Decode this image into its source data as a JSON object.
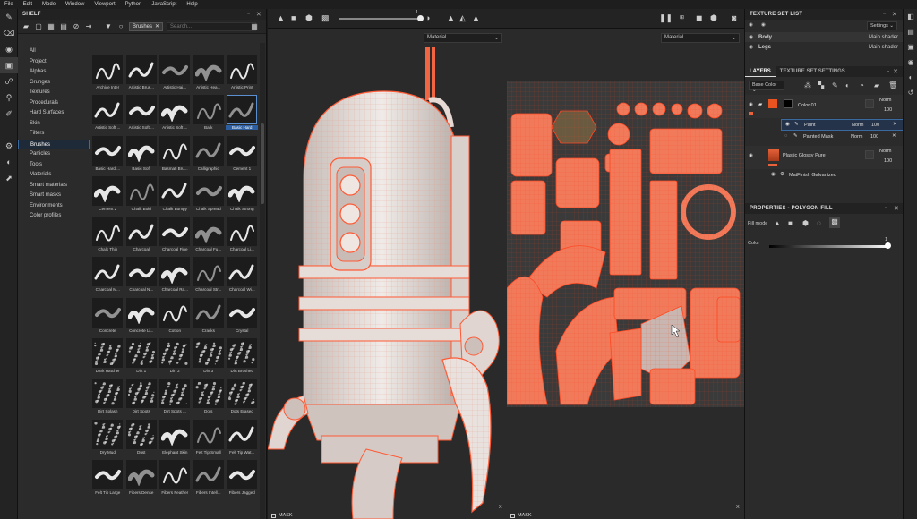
{
  "menu": [
    "File",
    "Edit",
    "Mode",
    "Window",
    "Viewport",
    "Python",
    "JavaScript",
    "Help"
  ],
  "shelf": {
    "title": "SHELF",
    "filter_chip": "Brushes",
    "search_placeholder": "Search...",
    "categories": [
      "All",
      "Project",
      "Alphas",
      "Grunges",
      "Textures",
      "Procedurals",
      "Hard Surfaces",
      "Skin",
      "Filters",
      "Brushes",
      "Particles",
      "Tools",
      "Materials",
      "Smart materials",
      "Smart masks",
      "Environments",
      "Color profiles"
    ],
    "selected_category": "Brushes",
    "brushes": [
      "Archive Inter",
      "Artistic Brus...",
      "Artistic Hai...",
      "Artistic Hea...",
      "Artistic Print",
      "Artistic Soft ...",
      "Artistic Soft ...",
      "Artistic Soft ...",
      "Bark",
      "Basic Hard",
      "Basic Hard ...",
      "Basic Soft",
      "Basmati Bru...",
      "Calligraphic",
      "Cement 1",
      "Cement 2",
      "Chalk Bold",
      "Chalk Bumpy",
      "Chalk Spread",
      "Chalk Strong",
      "Chalk Thin",
      "Charcoal",
      "Charcoal Fine",
      "Charcoal Fu...",
      "Charcoal Li...",
      "Charcoal M...",
      "Charcoal N...",
      "Charcoal Ra...",
      "Charcoal Str...",
      "Charcoal Wi...",
      "Concrete",
      "Concrete Li...",
      "Cotton",
      "Cracks",
      "Crystal",
      "Dark Hatcher",
      "Dirt 1",
      "Dirt 2",
      "Dirt 3",
      "Dirt Brushed",
      "Dirt Splash",
      "Dirt Spots",
      "Dirt Spots ...",
      "Dots",
      "Dots Erased",
      "Dry Mud",
      "Dust",
      "Elephant Skin",
      "Felt Tip Small",
      "Felt Tip Wat...",
      "Felt Tip Large",
      "Fibers Dense",
      "Fibers Feather",
      "Fibers Intell...",
      "Fibers Jagged"
    ],
    "selected_brush": "Basic Hard"
  },
  "viewport": {
    "slider_value": "1",
    "material_left": "Material",
    "material_right": "Material",
    "mask_left": "MASK",
    "mask_right": "MASK",
    "axis_left": "X",
    "axis_right": "X"
  },
  "texture_set_list": {
    "title": "TEXTURE SET LIST",
    "settings_label": "Settings",
    "items": [
      {
        "name": "Body",
        "shader": "Main shader"
      },
      {
        "name": "Legs",
        "shader": "Main shader"
      }
    ]
  },
  "layers": {
    "tab_layers": "LAYERS",
    "tab_settings": "TEXTURE SET SETTINGS",
    "channel": "Base Color",
    "rows": [
      {
        "name": "Color 01",
        "blend": "Norm",
        "opacity": "100"
      },
      {
        "name": "Paint",
        "blend": "Norm",
        "opacity": "100"
      },
      {
        "name": "Painted Mask",
        "blend": "Norm",
        "opacity": "100"
      },
      {
        "name": "Plastic Glossy Pure",
        "blend": "Norm",
        "opacity": "100"
      },
      {
        "name": "MatFinish Galvanized",
        "blend": "",
        "opacity": ""
      }
    ]
  },
  "properties": {
    "title": "PROPERTIES - POLYGON FILL",
    "fill_mode_label": "Fill mode",
    "color_label": "Color",
    "color_value": "1"
  },
  "colors": {
    "accent": "#e8633a",
    "wire": "#ff5a35",
    "selection": "#3b6aa0"
  }
}
